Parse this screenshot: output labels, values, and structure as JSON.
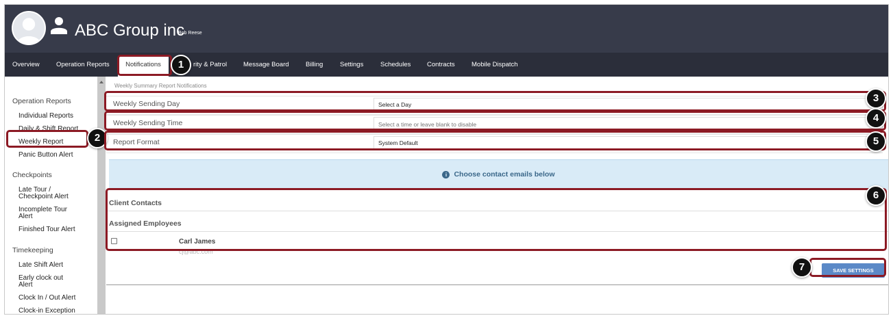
{
  "header": {
    "company": "ABC Group inc",
    "user_name": "Bob Reese"
  },
  "nav": {
    "items": [
      "Overview",
      "Operation Reports",
      "Notifications",
      "rity & Patrol",
      "Message Board",
      "Billing",
      "Settings",
      "Schedules",
      "Contracts",
      "Mobile Dispatch"
    ],
    "active": "Notifications"
  },
  "sidebar": {
    "groups": [
      {
        "heading": "Operation Reports",
        "items": [
          "Individual Reports",
          "Daily & Shift Report",
          "Weekly Report",
          "Panic Button Alert"
        ]
      },
      {
        "heading": "Checkpoints",
        "items": [
          "Late Tour /\nCheckpoint Alert",
          "Incomplete Tour\nAlert",
          "Finished Tour Alert"
        ]
      },
      {
        "heading": "Timekeeping",
        "items": [
          "Late Shift Alert",
          "Early clock out\nAlert",
          "Clock In / Out Alert",
          "Clock-in Exception"
        ]
      }
    ],
    "active_item": "Weekly Report"
  },
  "main": {
    "subtitle": "Weekly Summary Report Notifications",
    "fields": [
      {
        "label": "Weekly Sending Day",
        "value": "Select a Day"
      },
      {
        "label": "Weekly Sending Time",
        "placeholder": "Select a time or leave blank to disable"
      },
      {
        "label": "Report Format",
        "value": "System Default"
      }
    ],
    "info_text": "Choose contact emails below",
    "client_contacts_title": "Client Contacts",
    "assigned_employees_title": "Assigned Employees",
    "contact": {
      "name": "Carl James",
      "email": "cj@abc.com",
      "checked": false
    },
    "save_label": "SAVE SETTINGS"
  },
  "callouts": [
    "1",
    "2",
    "3",
    "4",
    "5",
    "6",
    "7"
  ],
  "colors": {
    "header": "#373b4a",
    "nav": "#2b2e3a",
    "callout": "#8c1a24",
    "info_bg": "#d9ebf7",
    "button": "#5b89c7"
  }
}
